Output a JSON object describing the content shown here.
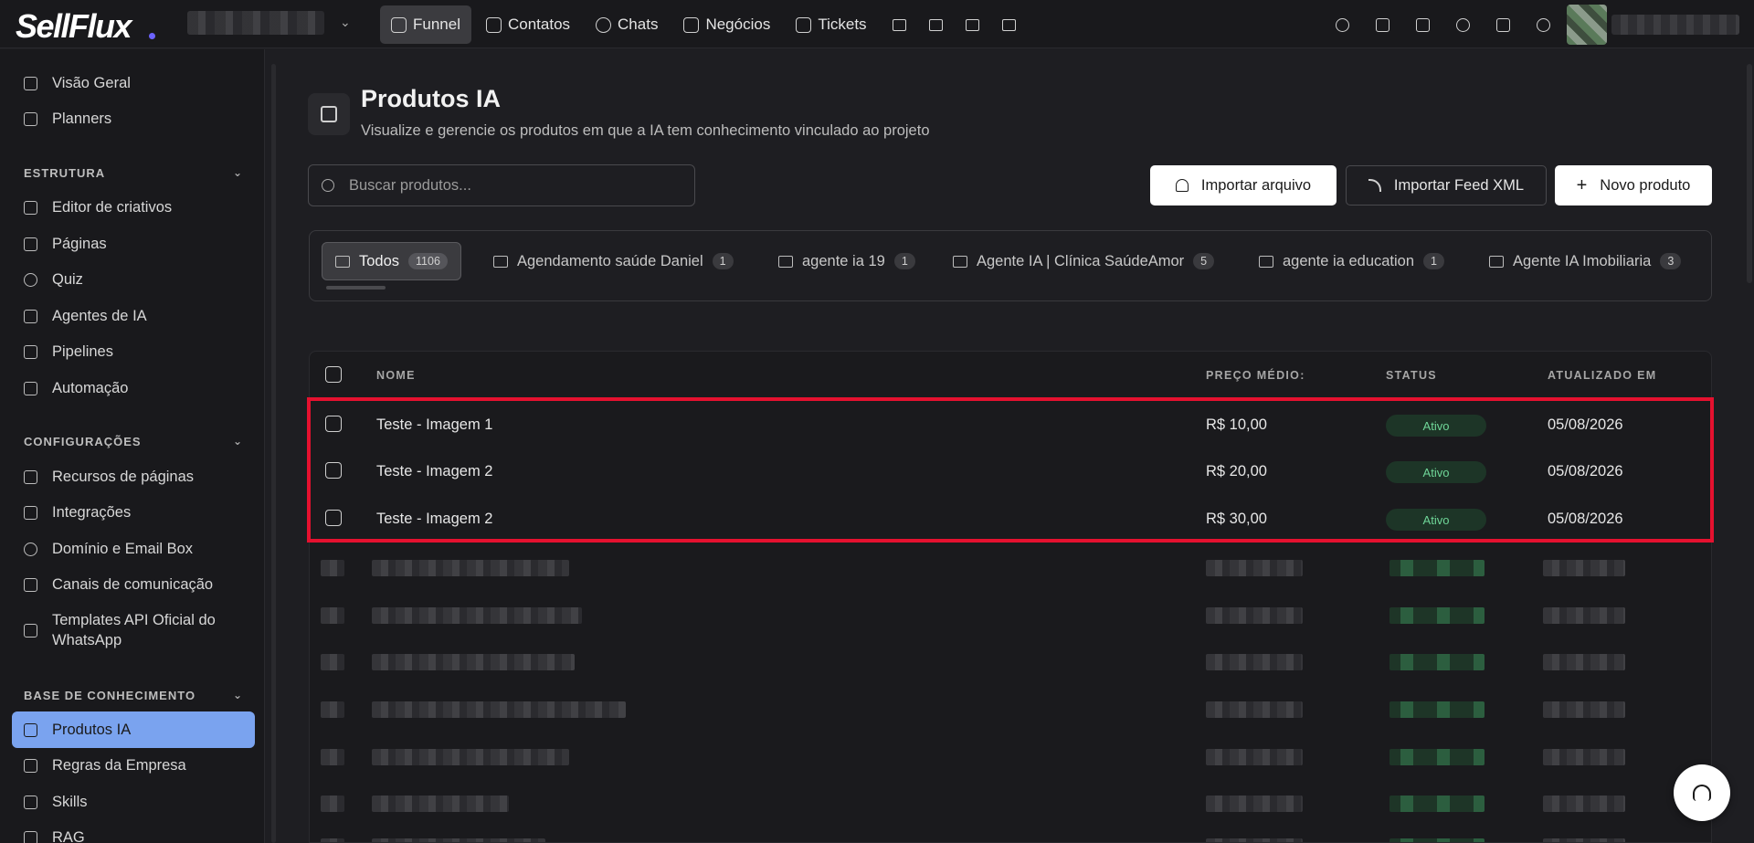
{
  "app": {
    "logo": "SellFlux",
    "brand_color": "#6c63ff"
  },
  "topnav": {
    "items": [
      {
        "label": "Funnel",
        "icon": "rocket-icon",
        "active": true
      },
      {
        "label": "Contatos",
        "icon": "contacts-icon"
      },
      {
        "label": "Chats",
        "icon": "chat-icon"
      },
      {
        "label": "Negócios",
        "icon": "briefcase-icon"
      },
      {
        "label": "Tickets",
        "icon": "ticket-icon"
      }
    ],
    "extra_icons": [
      "mail-icon",
      "message-square-icon",
      "calendar-icon",
      "bar-chart-icon"
    ],
    "right_icons": [
      "search-icon",
      "apps-grid-icon",
      "inbox-icon",
      "globe-icon",
      "book-icon",
      "headset-icon"
    ]
  },
  "sidebar": {
    "top_items": [
      {
        "label": "Visão Geral",
        "icon": "grid-icon"
      },
      {
        "label": "Planners",
        "icon": "calendar-icon"
      }
    ],
    "sections": [
      {
        "title": "ESTRUTURA",
        "items": [
          {
            "label": "Editor de criativos",
            "icon": "image-edit-icon"
          },
          {
            "label": "Páginas",
            "icon": "file-icon"
          },
          {
            "label": "Quiz",
            "icon": "help-circle-icon"
          },
          {
            "label": "Agentes de IA",
            "icon": "bot-icon"
          },
          {
            "label": "Pipelines",
            "icon": "grid-icon"
          },
          {
            "label": "Automação",
            "icon": "zap-icon"
          }
        ]
      },
      {
        "title": "CONFIGURAÇÕES",
        "items": [
          {
            "label": "Recursos de páginas",
            "icon": "file-icon"
          },
          {
            "label": "Integrações",
            "icon": "plug-icon"
          },
          {
            "label": "Domínio e Email Box",
            "icon": "globe-icon"
          },
          {
            "label": "Canais de comunicação",
            "icon": "message-square-icon"
          },
          {
            "label": "Templates API Oficial do WhatsApp",
            "icon": "file-code-icon"
          }
        ]
      },
      {
        "title": "BASE DE CONHECIMENTO",
        "items": [
          {
            "label": "Produtos IA",
            "icon": "chip-icon",
            "active": true
          },
          {
            "label": "Regras da Empresa",
            "icon": "rules-icon"
          },
          {
            "label": "Skills",
            "icon": "zap-icon"
          },
          {
            "label": "RAG",
            "icon": "database-icon"
          }
        ]
      }
    ]
  },
  "page": {
    "title": "Produtos IA",
    "subtitle": "Visualize e gerencie os produtos em que a IA tem conhecimento vinculado ao projeto",
    "search_placeholder": "Buscar produtos...",
    "buttons": {
      "import_file": "Importar arquivo",
      "import_feed": "Importar Feed XML",
      "new_product": "Novo produto"
    }
  },
  "folders": [
    {
      "label": "Todos",
      "count": "1106",
      "active": true
    },
    {
      "label": "Agendamento saúde Daniel",
      "count": "1"
    },
    {
      "label": "agente ia 19",
      "count": "1"
    },
    {
      "label": "Agente IA | Clínica SaúdeAmor",
      "count": "5"
    },
    {
      "label": "agente ia education",
      "count": "1"
    },
    {
      "label": "Agente IA Imobiliaria",
      "count": "3"
    }
  ],
  "table": {
    "columns": [
      "NOME",
      "PREÇO MÉDIO:",
      "STATUS",
      "ATUALIZADO EM"
    ],
    "rows": [
      {
        "name": "Teste - Imagem 1",
        "price": "R$ 10,00",
        "status": "Ativo",
        "updated": "05/08/2026"
      },
      {
        "name": "Teste - Imagem 2",
        "price": "R$ 20,00",
        "status": "Ativo",
        "updated": "05/08/2026"
      },
      {
        "name": "Teste - Imagem 2",
        "price": "R$ 30,00",
        "status": "Ativo",
        "updated": "05/08/2026"
      }
    ],
    "status_color": "#6fd698",
    "highlight_color": "#e5112f"
  }
}
